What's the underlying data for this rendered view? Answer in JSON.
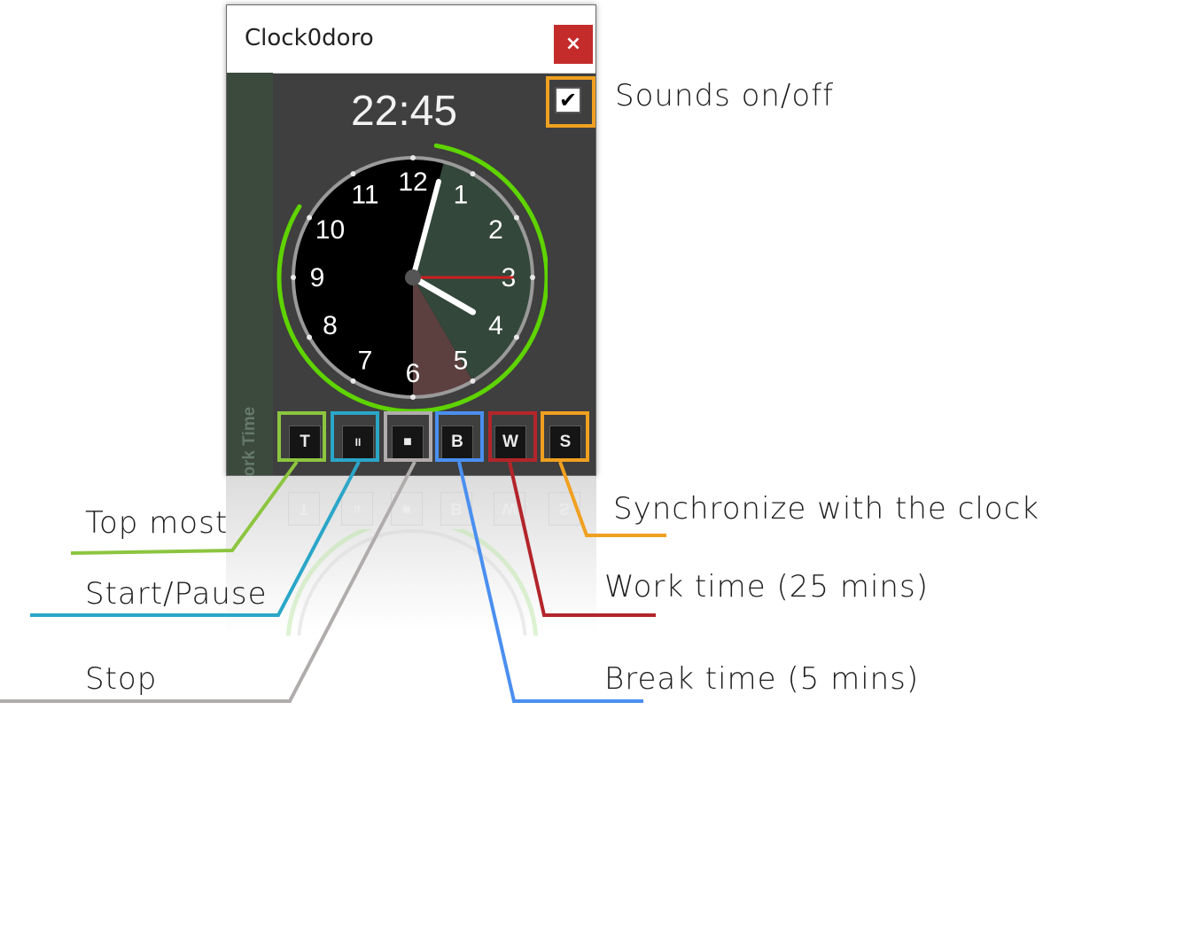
{
  "window": {
    "title": "Clock0doro",
    "close_label": "×",
    "time": "22:45",
    "side_label": "Work Time",
    "sound_check": "✔"
  },
  "clock": {
    "numerals": [
      "12",
      "1",
      "2",
      "3",
      "4",
      "5",
      "6",
      "7",
      "8",
      "9",
      "10",
      "11"
    ],
    "hour_hand_at_hours": 4.0,
    "minute_hand_at_minutes": 2.5,
    "second_hand_at_seconds": 15,
    "ring_color": "#5fd400",
    "work_sector_color": "#33473a",
    "break_sector_color": "#5c4040",
    "second_hand_color": "#cc1f1f"
  },
  "toolbar": {
    "buttons": [
      {
        "label": "T",
        "name": "topmost-button"
      },
      {
        "label": "II",
        "name": "start-pause-button"
      },
      {
        "label": "■",
        "name": "stop-button"
      },
      {
        "label": "B",
        "name": "break-time-button"
      },
      {
        "label": "W",
        "name": "work-time-button"
      },
      {
        "label": "S",
        "name": "sync-button"
      }
    ]
  },
  "annotations": {
    "sounds": "Sounds on/off",
    "topmost": "Top most",
    "start_pause": "Start/Pause",
    "stop": "Stop",
    "sync": "Synchronize with the clock",
    "work": "Work time (25 mins)",
    "break": "Break time (5 mins)"
  },
  "colors": {
    "topmost": "#8cc53f",
    "start_pause": "#2aa6c8",
    "stop": "#b0acac",
    "break": "#4a8ff0",
    "work": "#b3252b",
    "sync": "#f0a020",
    "sounds": "#f0a020"
  }
}
